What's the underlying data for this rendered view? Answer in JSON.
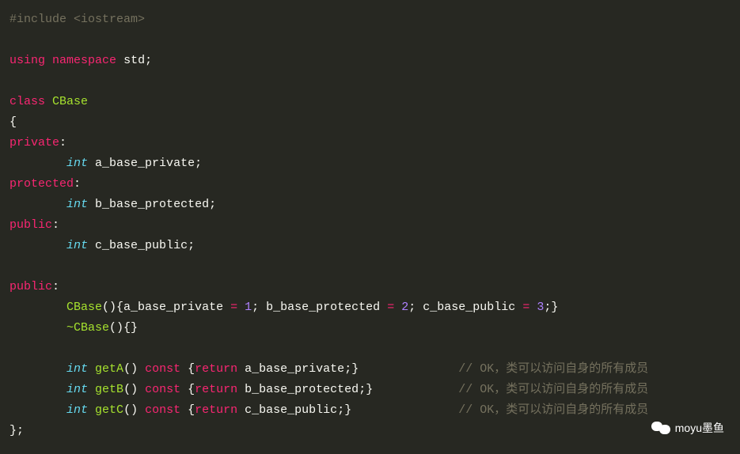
{
  "code": {
    "line1": {
      "directive": "#include",
      "header": "<iostream>"
    },
    "line3": {
      "using": "using",
      "namespace": "namespace",
      "std": "std"
    },
    "line5": {
      "class": "class",
      "name": "CBase"
    },
    "brace_open": "{",
    "private": "private",
    "protected": "protected",
    "public": "public",
    "semicolon": ":",
    "int": "int",
    "var_a": "a_base_private",
    "var_b": "b_base_protected",
    "var_c": "c_base_public",
    "ctor": "CBase",
    "dtor": "~CBase",
    "num1": "1",
    "num2": "2",
    "num3": "3",
    "getA": "getA",
    "getB": "getB",
    "getC": "getC",
    "const": "const",
    "return": "return",
    "brace_close": "};",
    "comment1": "// OK，类可以访问自身的所有成员",
    "comment2": "// OK，类可以访问自身的所有成员",
    "comment3": "// OK，类可以访问自身的所有成员"
  },
  "watermark": "moyu墨鱼"
}
